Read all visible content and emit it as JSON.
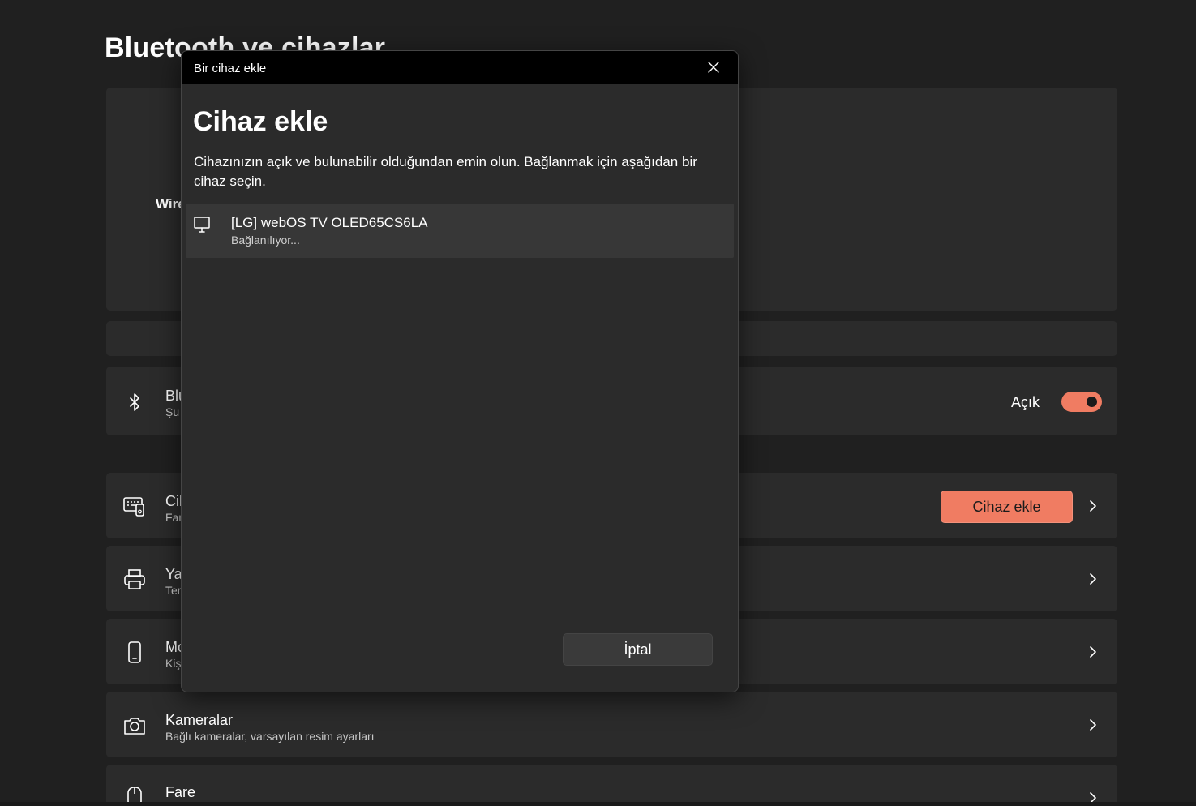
{
  "page": {
    "title": "Bluetooth ve cihazlar"
  },
  "hero": {
    "wireless_label": "Wire"
  },
  "rows": {
    "bluetooth": {
      "title": "Blu",
      "subtitle": "Şu",
      "toggle_label": "Açık",
      "toggle_on": true
    },
    "devices": {
      "title": "Cih",
      "subtitle": "Far",
      "button_label": "Cihaz ekle"
    },
    "printers": {
      "title": "Yaz",
      "subtitle": "Ter"
    },
    "mobile": {
      "title": "Mo",
      "subtitle": "Kiş"
    },
    "cameras": {
      "title": "Kameralar",
      "subtitle": "Bağlı kameralar, varsayılan resim ayarları"
    },
    "mouse": {
      "title": "Fare"
    }
  },
  "dialog": {
    "titlebar": "Bir cihaz ekle",
    "heading": "Cihaz ekle",
    "description": "Cihazınızın açık ve bulunabilir olduğundan emin olun. Bağlanmak için aşağıdan bir cihaz seçin.",
    "device": {
      "name": "[LG] webOS TV OLED65CS6LA",
      "status": "Bağlanılıyor..."
    },
    "cancel_label": "İptal"
  },
  "colors": {
    "accent": "#f07c62",
    "background": "#202020",
    "card": "#2b2b2b"
  }
}
